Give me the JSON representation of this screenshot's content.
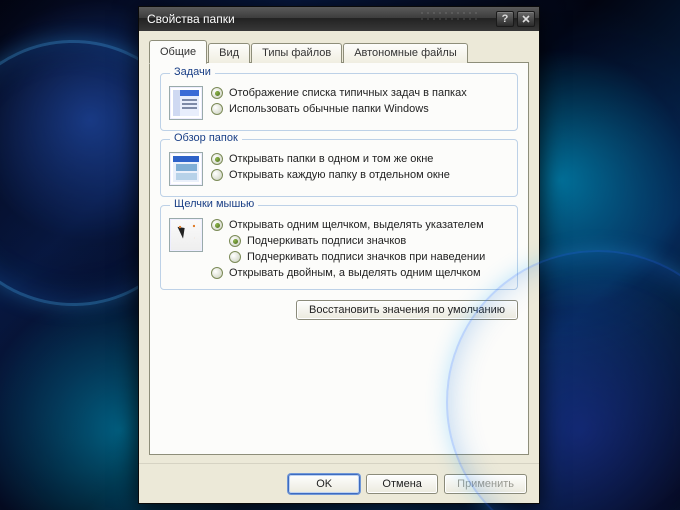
{
  "window": {
    "title": "Свойства папки"
  },
  "tabs": [
    {
      "label": "Общие",
      "active": true
    },
    {
      "label": "Вид"
    },
    {
      "label": "Типы файлов"
    },
    {
      "label": "Автономные файлы"
    }
  ],
  "groups": {
    "tasks": {
      "legend": "Задачи",
      "options": [
        {
          "label": "Отображение списка типичных задач в папках",
          "checked": true
        },
        {
          "label": "Использовать обычные папки Windows",
          "checked": false
        }
      ]
    },
    "browse": {
      "legend": "Обзор папок",
      "options": [
        {
          "label": "Открывать папки в одном и том же окне",
          "checked": true
        },
        {
          "label": "Открывать каждую папку в отдельном окне",
          "checked": false
        }
      ]
    },
    "click": {
      "legend": "Щелчки мышью",
      "options": [
        {
          "label": "Открывать одним щелчком, выделять указателем",
          "checked": true
        },
        {
          "label": "Подчеркивать подписи значков",
          "checked": true,
          "indent": true
        },
        {
          "label": "Подчеркивать подписи значков при наведении",
          "checked": false,
          "indent": true
        },
        {
          "label": "Открывать двойным, а выделять одним щелчком",
          "checked": false
        }
      ]
    }
  },
  "buttons": {
    "restore": "Восстановить значения по умолчанию",
    "ok": "OK",
    "cancel": "Отмена",
    "apply": "Применить"
  }
}
